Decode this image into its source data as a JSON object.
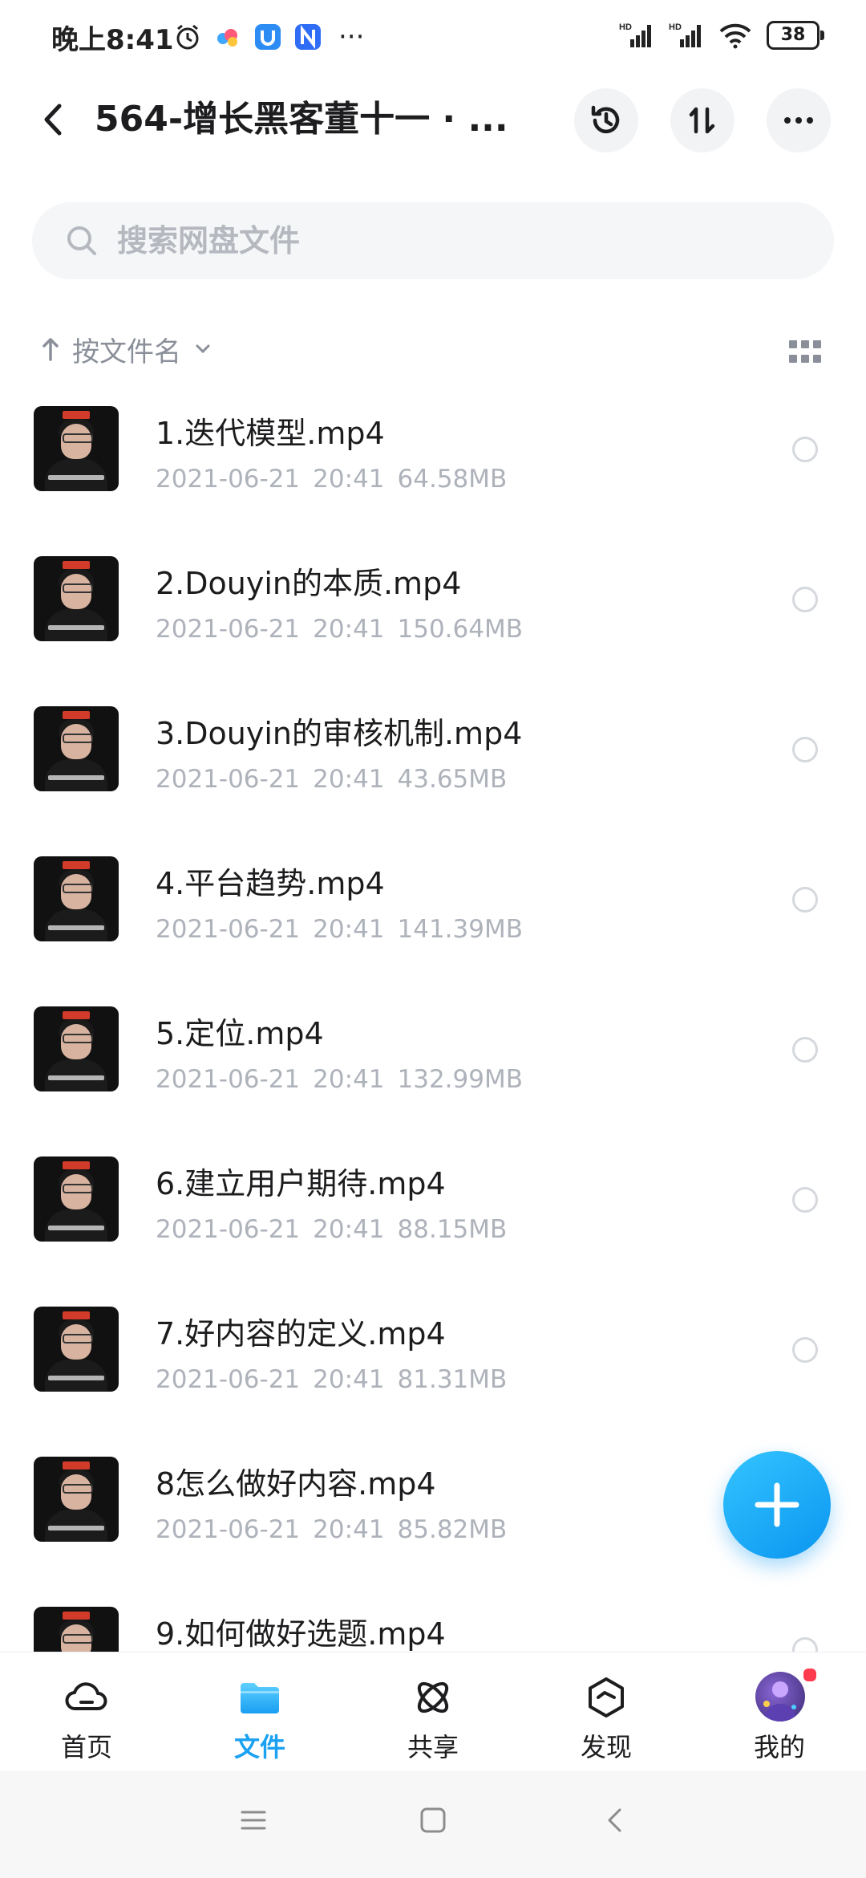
{
  "status_bar": {
    "time": "晚上8:41",
    "battery": "38",
    "network_label_1": "HD",
    "network_label_2": "HD"
  },
  "header": {
    "title": "564-增长黑客董十一 · ...",
    "back_icon": "back-arrow-icon",
    "history_icon": "history-icon",
    "sort_icon": "sort-icon",
    "more_icon": "more-icon"
  },
  "search": {
    "placeholder": "搜索网盘文件"
  },
  "sort": {
    "label": "按文件名"
  },
  "files": [
    {
      "name": "1.迭代模型.mp4",
      "date": "2021-06-21",
      "time": "20:41",
      "size": "64.58MB"
    },
    {
      "name": "2.Douyin的本质.mp4",
      "date": "2021-06-21",
      "time": "20:41",
      "size": "150.64MB"
    },
    {
      "name": "3.Douyin的审核机制.mp4",
      "date": "2021-06-21",
      "time": "20:41",
      "size": "43.65MB"
    },
    {
      "name": "4.平台趋势.mp4",
      "date": "2021-06-21",
      "time": "20:41",
      "size": "141.39MB"
    },
    {
      "name": "5.定位.mp4",
      "date": "2021-06-21",
      "time": "20:41",
      "size": "132.99MB"
    },
    {
      "name": "6.建立用户期待.mp4",
      "date": "2021-06-21",
      "time": "20:41",
      "size": "88.15MB"
    },
    {
      "name": "7.好内容的定义.mp4",
      "date": "2021-06-21",
      "time": "20:41",
      "size": "81.31MB"
    },
    {
      "name": "8怎么做好内容.mp4",
      "date": "2021-06-21",
      "time": "20:41",
      "size": "85.82MB"
    },
    {
      "name": "9.如何做好选题.mp4",
      "date": "",
      "time": "",
      "size": ""
    }
  ],
  "tabs": [
    {
      "label": "首页",
      "icon": "cloud-home-icon",
      "active": false
    },
    {
      "label": "文件",
      "icon": "folder-icon",
      "active": true
    },
    {
      "label": "共享",
      "icon": "share-atom-icon",
      "active": false
    },
    {
      "label": "发现",
      "icon": "discover-icon",
      "active": false
    },
    {
      "label": "我的",
      "icon": "avatar-icon",
      "active": false
    }
  ],
  "colors": {
    "accent": "#1aa1f2",
    "fab_top": "#34c4ff",
    "fab_bottom": "#0a96f0",
    "badge": "#ff3b4e"
  }
}
